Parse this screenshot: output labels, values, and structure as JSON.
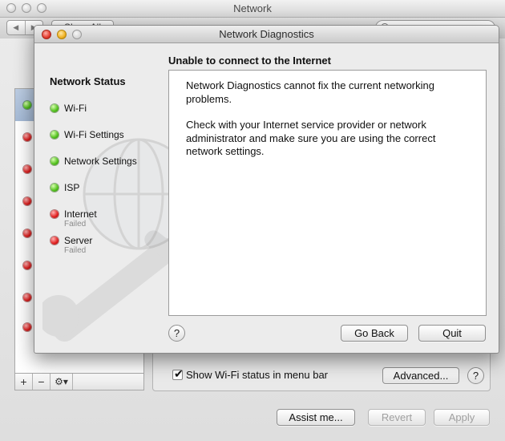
{
  "back_window": {
    "title": "Network",
    "show_all_label": "Show All",
    "show_wifi_status_label": "Show Wi-Fi status in menu bar",
    "advanced_label": "Advanced...",
    "help_label": "?",
    "assist_label": "Assist me...",
    "revert_label": "Revert",
    "apply_label": "Apply",
    "list_tools": {
      "add": "+",
      "remove": "−",
      "gear": "⚙▾"
    }
  },
  "diagnostics": {
    "title": "Network Diagnostics",
    "sidebar_heading": "Network Status",
    "steps": [
      {
        "label": "Wi-Fi",
        "status": "ok",
        "sub": ""
      },
      {
        "label": "Wi-Fi Settings",
        "status": "ok",
        "sub": ""
      },
      {
        "label": "Network Settings",
        "status": "ok",
        "sub": ""
      },
      {
        "label": "ISP",
        "status": "ok",
        "sub": ""
      },
      {
        "label": "Internet",
        "status": "failed",
        "sub": "Failed"
      },
      {
        "label": "Server",
        "status": "failed",
        "sub": "Failed"
      }
    ],
    "heading": "Unable to connect to the Internet",
    "message_1": "Network Diagnostics cannot fix the current networking problems.",
    "message_2": "Check with your Internet service provider or network administrator and make sure you are using the correct network settings.",
    "help_label": "?",
    "go_back_label": "Go Back",
    "quit_label": "Quit"
  },
  "colors": {
    "ok": "#4fbf1a",
    "failed": "#e01d1d"
  }
}
